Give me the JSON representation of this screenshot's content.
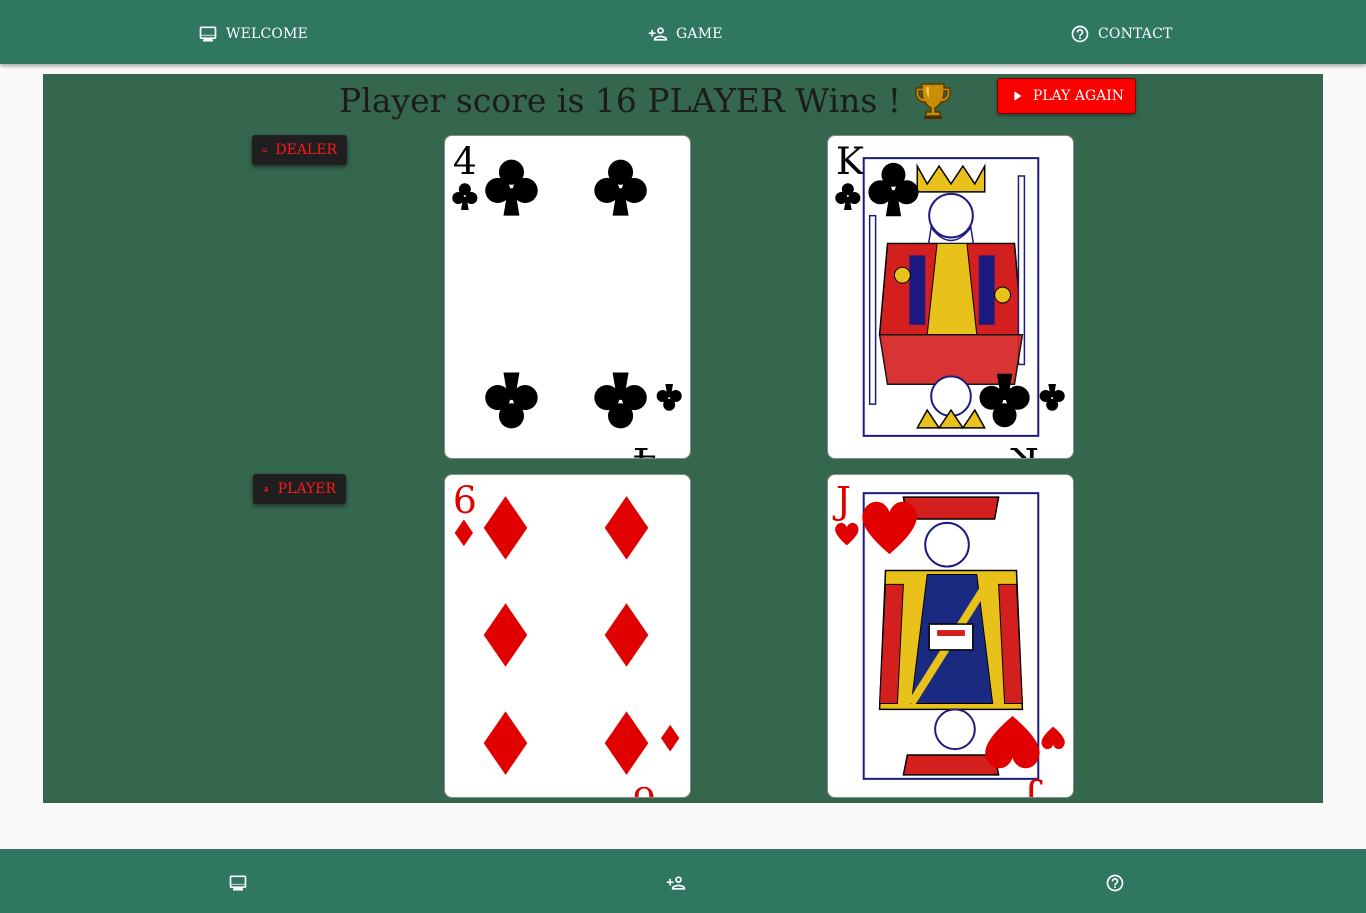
{
  "nav": {
    "items": [
      {
        "label": "WELCOME",
        "icon": "monitor-icon"
      },
      {
        "label": "GAME",
        "icon": "group-add-icon"
      },
      {
        "label": "CONTACT",
        "icon": "help-circle-icon"
      }
    ]
  },
  "game": {
    "result_text": "Player score is 16 PLAYER Wins !",
    "play_again_label": "PLAY AGAIN",
    "dealer_label": "DEALER",
    "player_label": "PLAYER",
    "dealer_cards": [
      {
        "rank": "4",
        "suit": "clubs"
      },
      {
        "rank": "K",
        "suit": "clubs"
      }
    ],
    "player_cards": [
      {
        "rank": "6",
        "suit": "diamonds"
      },
      {
        "rank": "J",
        "suit": "hearts"
      }
    ]
  },
  "colors": {
    "nav_bar": "#2f7760",
    "table": "#35664e",
    "play_again": "#fc0000",
    "badge_text": "#ff1a1a",
    "red_suit": "#e00000"
  }
}
